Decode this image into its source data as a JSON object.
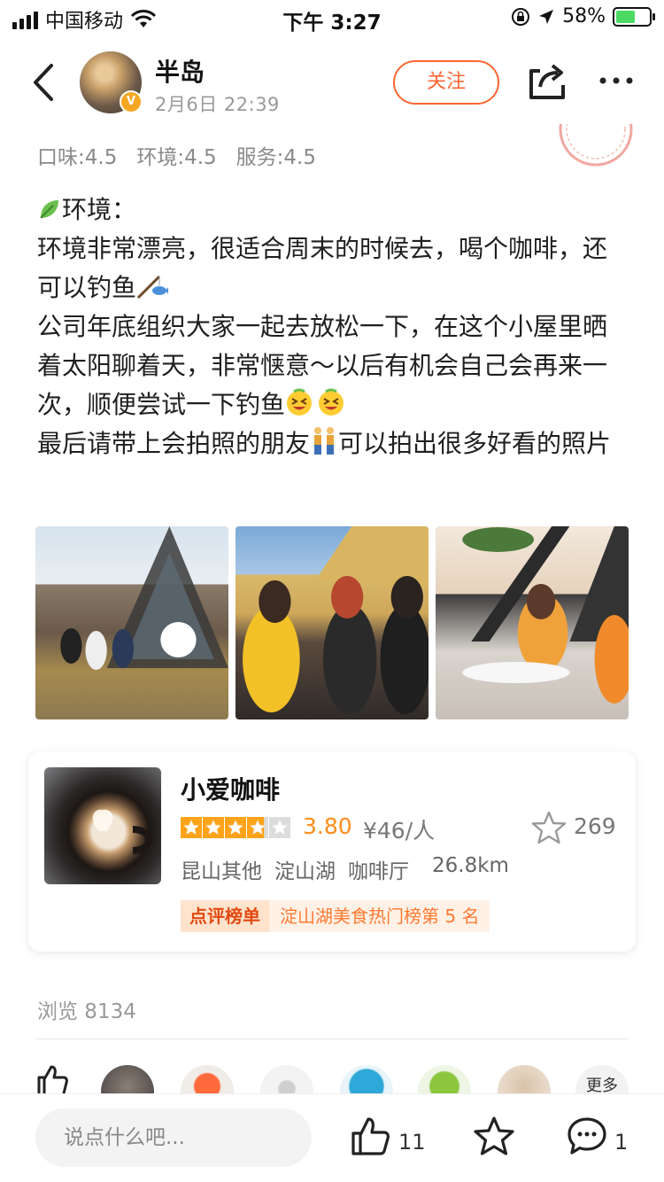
{
  "status_bar": {
    "carrier": "中国移动",
    "time": "下午 3:27",
    "battery": "58%",
    "battery_level": 0.58,
    "icons": [
      "signal-icon",
      "wifi-icon",
      "orientation-lock-icon",
      "location-icon",
      "battery-icon"
    ]
  },
  "header": {
    "user_name": "半岛",
    "post_time": "2月6日  22:39",
    "verified_badge": "V",
    "follow_label": "关注",
    "icons": [
      "back-icon",
      "share-icon",
      "more-icon"
    ]
  },
  "ratings": {
    "taste": "口味:4.5",
    "environment": "环境:4.5",
    "service": "服务:4.5"
  },
  "review": {
    "line1": "环境：",
    "line2": "环境非常漂亮，很适合周末的时候去，喝个咖啡，还可以钓鱼",
    "line3": "公司年底组织大家一起去放松一下，在这个小屋里晒着太阳聊着天，非常惬意～以后有机会自己会再来一次，顺便尝试一下钓鱼",
    "line4a": "最后请带上会拍照的朋友",
    "line4b": "可以拍出很多好看的照片"
  },
  "shop": {
    "name": "小爱咖啡",
    "rating": 3.8,
    "score": "3.80",
    "price": "¥46/人",
    "favorites": "269",
    "region": "昆山其他",
    "area": "淀山湖",
    "category": "咖啡厅",
    "distance": "26.8km",
    "rank_label": "点评榜单",
    "rank_text": "淀山湖美食热门榜第 5 名"
  },
  "views": "浏览 8134",
  "likers": {
    "more_label": "更多"
  },
  "bottom_bar": {
    "comment_placeholder": "说点什么吧...",
    "like_count": "11",
    "comment_count": "1"
  },
  "colors": {
    "accent": "#ff6633",
    "star": "#ffa31a",
    "score": "#ff8c1a"
  }
}
